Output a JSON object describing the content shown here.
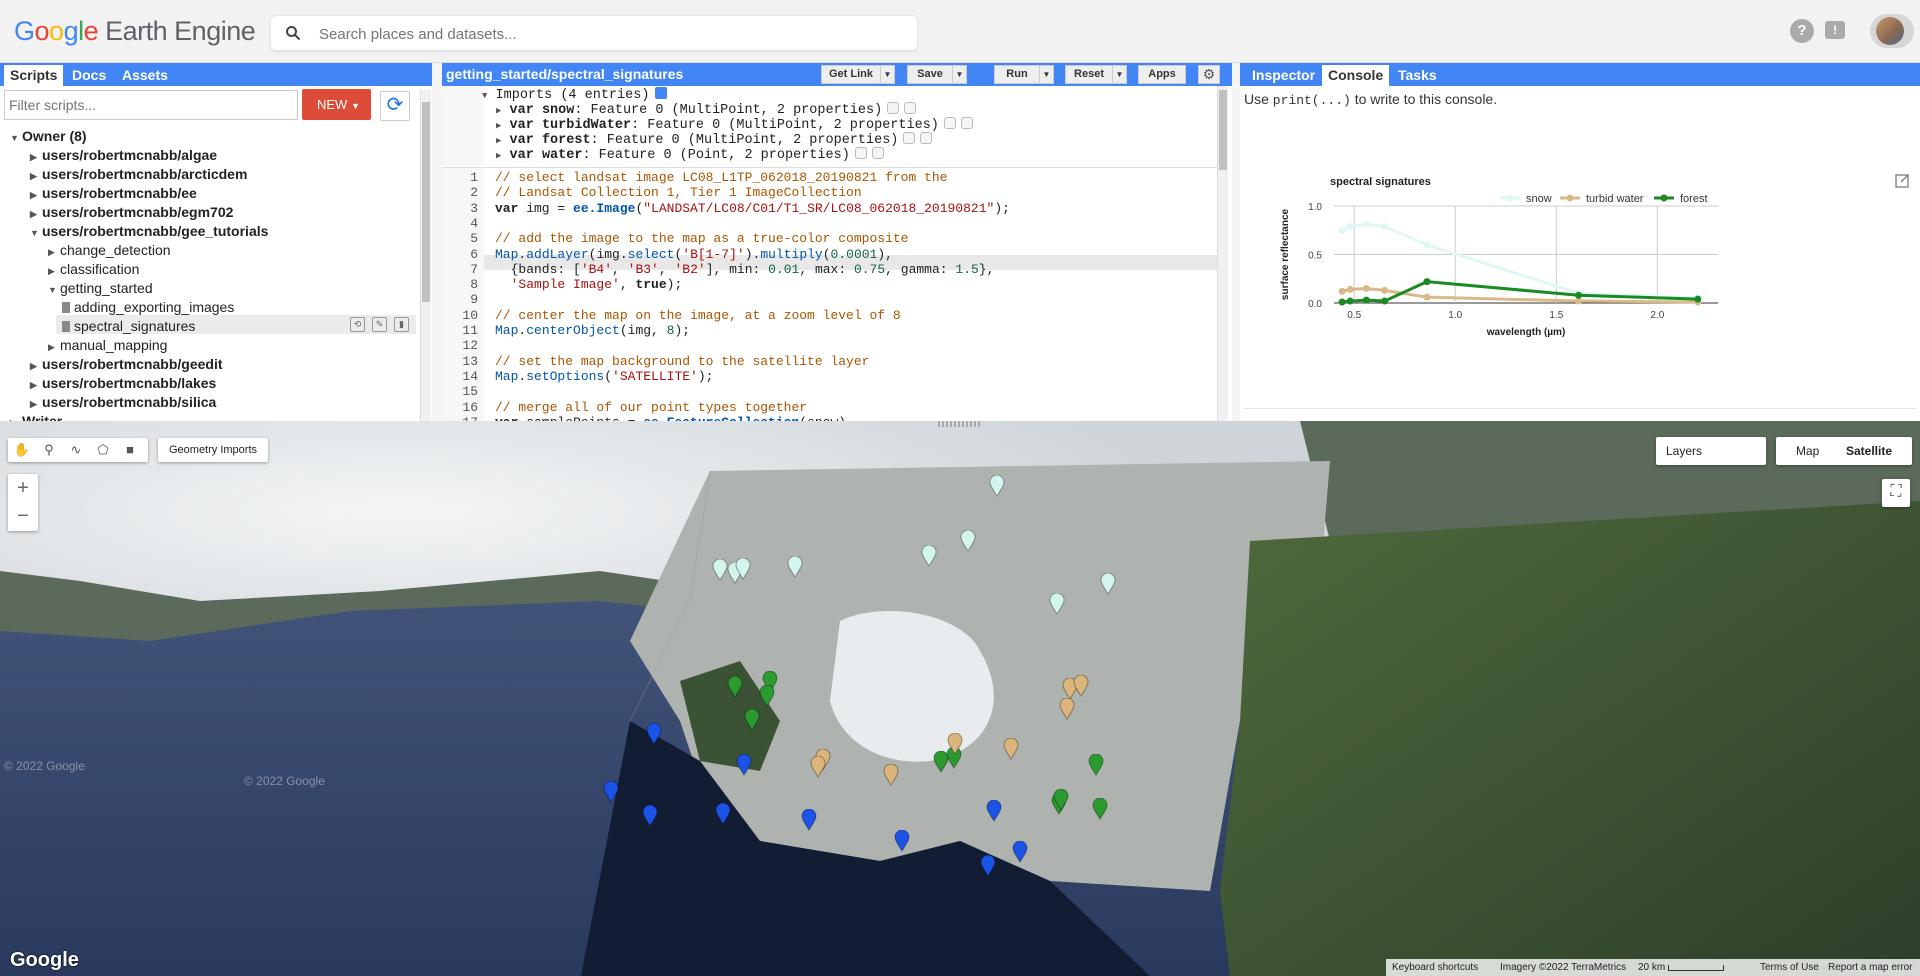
{
  "app": {
    "logo_google": "Google",
    "logo_product": "Earth Engine",
    "search_placeholder": "Search places and datasets...",
    "help_icon": "help-icon",
    "feedback_icon": "feedback-icon"
  },
  "left": {
    "tabs": [
      "Scripts",
      "Docs",
      "Assets"
    ],
    "filter_placeholder": "Filter scripts...",
    "new_label": "NEW",
    "tree": [
      {
        "label": "Owner (8)",
        "bold": true,
        "expanded": true,
        "depth": 0,
        "kind": "folder"
      },
      {
        "label": "users/robertmcnabb/algae",
        "bold": true,
        "expanded": false,
        "depth": 1,
        "kind": "folder"
      },
      {
        "label": "users/robertmcnabb/arcticdem",
        "bold": true,
        "expanded": false,
        "depth": 1,
        "kind": "folder"
      },
      {
        "label": "users/robertmcnabb/ee",
        "bold": true,
        "expanded": false,
        "depth": 1,
        "kind": "folder"
      },
      {
        "label": "users/robertmcnabb/egm702",
        "bold": true,
        "expanded": false,
        "depth": 1,
        "kind": "folder"
      },
      {
        "label": "users/robertmcnabb/gee_tutorials",
        "bold": true,
        "expanded": true,
        "depth": 1,
        "kind": "folder"
      },
      {
        "label": "change_detection",
        "bold": false,
        "expanded": false,
        "depth": 2,
        "kind": "folder"
      },
      {
        "label": "classification",
        "bold": false,
        "expanded": false,
        "depth": 2,
        "kind": "folder"
      },
      {
        "label": "getting_started",
        "bold": false,
        "expanded": true,
        "depth": 2,
        "kind": "folder"
      },
      {
        "label": "adding_exporting_images",
        "bold": false,
        "depth": 3,
        "kind": "file"
      },
      {
        "label": "spectral_signatures",
        "bold": false,
        "depth": 3,
        "kind": "file"
      },
      {
        "label": "manual_mapping",
        "bold": false,
        "expanded": false,
        "depth": 2,
        "kind": "folder"
      },
      {
        "label": "users/robertmcnabb/geedit",
        "bold": true,
        "expanded": false,
        "depth": 1,
        "kind": "folder"
      },
      {
        "label": "users/robertmcnabb/lakes",
        "bold": true,
        "expanded": false,
        "depth": 1,
        "kind": "folder"
      },
      {
        "label": "users/robertmcnabb/silica",
        "bold": true,
        "expanded": false,
        "depth": 1,
        "kind": "folder"
      },
      {
        "label": "Writer",
        "bold": true,
        "expanded": false,
        "depth": 0,
        "kind": "folder"
      }
    ]
  },
  "editor": {
    "title": "getting_started/spectral_signatures",
    "buttons": {
      "get_link": "Get Link",
      "save": "Save",
      "run": "Run",
      "reset": "Reset",
      "apps": "Apps"
    },
    "imports_header": "Imports (4 entries)",
    "imports": [
      {
        "name": "snow",
        "desc": ": Feature 0 (MultiPoint, 2 properties)"
      },
      {
        "name": "turbidWater",
        "desc": ": Feature 0 (MultiPoint, 2 properties)"
      },
      {
        "name": "forest",
        "desc": ": Feature 0 (MultiPoint, 2 properties)"
      },
      {
        "name": "water",
        "desc": ": Feature 0 (Point, 2 properties)"
      }
    ],
    "code_lines": [
      [
        {
          "t": "// select landsat image LC08_L1TP_062018_20190821 from the",
          "c": "cmt"
        }
      ],
      [
        {
          "t": "// Landsat Collection 1, Tier 1 ImageCollection",
          "c": "cmt"
        }
      ],
      [
        {
          "t": "var",
          "c": "kw"
        },
        {
          "t": " img = "
        },
        {
          "t": "ee.Image",
          "c": "fnb"
        },
        {
          "t": "("
        },
        {
          "t": "\"LANDSAT/LC08/C01/T1_SR/LC08_062018_20190821\"",
          "c": "str"
        },
        {
          "t": ");"
        }
      ],
      [
        {
          "t": ""
        }
      ],
      [
        {
          "t": "// add the image to the map as a true-color composite",
          "c": "cmt"
        }
      ],
      [
        {
          "t": "Map",
          "c": "fn"
        },
        {
          "t": "."
        },
        {
          "t": "addLayer",
          "c": "fn"
        },
        {
          "t": "(img."
        },
        {
          "t": "select",
          "c": "fn"
        },
        {
          "t": "("
        },
        {
          "t": "'B[1-7]'",
          "c": "str"
        },
        {
          "t": ")."
        },
        {
          "t": "multiply",
          "c": "fn"
        },
        {
          "t": "("
        },
        {
          "t": "0.0001",
          "c": "num"
        },
        {
          "t": "),"
        }
      ],
      [
        {
          "t": "  {bands: ["
        },
        {
          "t": "'B4'",
          "c": "str"
        },
        {
          "t": ", "
        },
        {
          "t": "'B3'",
          "c": "str"
        },
        {
          "t": ", "
        },
        {
          "t": "'B2'",
          "c": "str"
        },
        {
          "t": "], min: "
        },
        {
          "t": "0.01",
          "c": "num"
        },
        {
          "t": ", max: "
        },
        {
          "t": "0.75",
          "c": "num"
        },
        {
          "t": ", gamma: "
        },
        {
          "t": "1.5",
          "c": "num"
        },
        {
          "t": "},"
        }
      ],
      [
        {
          "t": "  "
        },
        {
          "t": "'Sample Image'",
          "c": "str"
        },
        {
          "t": ", "
        },
        {
          "t": "true",
          "c": "kw"
        },
        {
          "t": ");"
        }
      ],
      [
        {
          "t": ""
        }
      ],
      [
        {
          "t": "// center the map on the image, at a zoom level of 8",
          "c": "cmt"
        }
      ],
      [
        {
          "t": "Map",
          "c": "fn"
        },
        {
          "t": "."
        },
        {
          "t": "centerObject",
          "c": "fn"
        },
        {
          "t": "(img, "
        },
        {
          "t": "8",
          "c": "num"
        },
        {
          "t": ");"
        }
      ],
      [
        {
          "t": ""
        }
      ],
      [
        {
          "t": "// set the map background to the satellite layer",
          "c": "cmt"
        }
      ],
      [
        {
          "t": "Map",
          "c": "fn"
        },
        {
          "t": "."
        },
        {
          "t": "setOptions",
          "c": "fn"
        },
        {
          "t": "("
        },
        {
          "t": "'SATELLITE'",
          "c": "str"
        },
        {
          "t": ");"
        }
      ],
      [
        {
          "t": ""
        }
      ],
      [
        {
          "t": "// merge all of our point types together",
          "c": "cmt"
        }
      ],
      [
        {
          "t": "var",
          "c": "kw"
        },
        {
          "t": " samplePoints = "
        },
        {
          "t": "ee.FeatureCollection",
          "c": "fnb"
        },
        {
          "t": "(snow)"
        }
      ]
    ]
  },
  "right": {
    "tabs": [
      "Inspector",
      "Console",
      "Tasks"
    ],
    "console_msg_pre": "Use ",
    "console_msg_code": "print(...)",
    "console_msg_post": " to write to this console."
  },
  "chart_data": {
    "type": "line",
    "title": "spectral signatures",
    "xlabel": "wavelength (µm)",
    "ylabel": "surface reflectance",
    "x": [
      0.44,
      0.48,
      0.56,
      0.65,
      0.86,
      1.61,
      2.2
    ],
    "xlim": [
      0.4,
      2.3
    ],
    "ylim": [
      0.0,
      1.0
    ],
    "xticks": [
      0.5,
      1.0,
      1.5,
      2.0
    ],
    "yticks": [
      0.0,
      0.5,
      1.0
    ],
    "xtick_labels": [
      "0.5",
      "1.0",
      "1.5",
      "2.0"
    ],
    "ytick_labels": [
      "0.0",
      "0.5",
      "1.0"
    ],
    "grid": true,
    "legend_position": "top-right",
    "series": [
      {
        "name": "snow",
        "color": "#e0f7f4",
        "values": [
          0.75,
          0.79,
          0.81,
          0.79,
          0.6,
          0.1,
          0.05
        ]
      },
      {
        "name": "turbid water",
        "color": "#d8b987",
        "values": [
          0.12,
          0.14,
          0.15,
          0.13,
          0.06,
          0.02,
          0.01
        ]
      },
      {
        "name": "forest",
        "color": "#1a8a23",
        "values": [
          0.01,
          0.02,
          0.03,
          0.02,
          0.22,
          0.08,
          0.04
        ]
      }
    ]
  },
  "map": {
    "geometry_imports": "Geometry Imports",
    "zoom_in": "+",
    "zoom_out": "−",
    "layers": "Layers",
    "maptype_map": "Map",
    "maptype_satellite": "Satellite",
    "google": "Google",
    "watermark1": "© 2022 Google",
    "watermark2": "© 2022 Google",
    "footer": {
      "shortcuts": "Keyboard shortcuts",
      "imagery": "Imagery ©2022 TerraMetrics",
      "scale": "20 km",
      "terms": "Terms of Use",
      "report": "Report a map error"
    },
    "marker_colors": {
      "snow": "#d4f4ee",
      "turbid": "#dcb57c",
      "forest": "#2b9a2f",
      "water": "#1a53e6"
    }
  }
}
